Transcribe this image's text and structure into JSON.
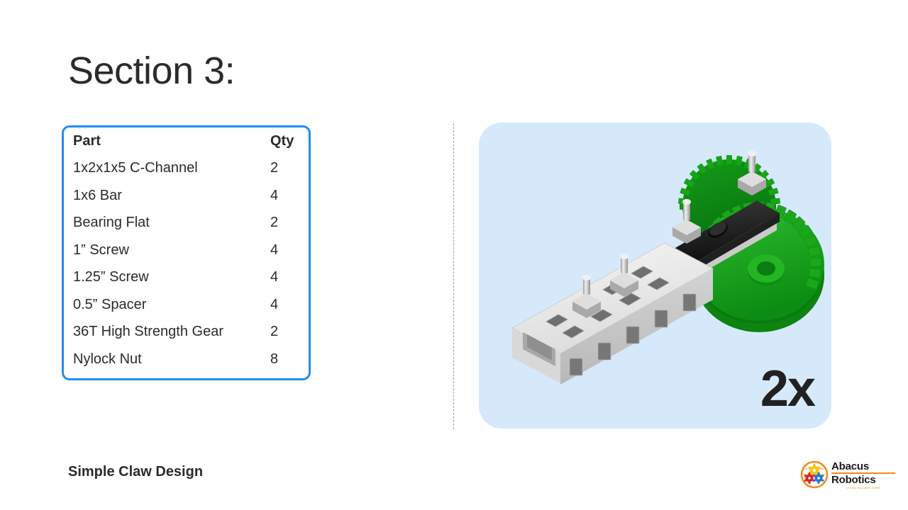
{
  "slide": {
    "title": "Section 3:",
    "footer_label": "Simple Claw Design"
  },
  "parts_table": {
    "columns": [
      "Part",
      "Qty"
    ],
    "rows": [
      {
        "part": "1x2x1x5 C-Channel",
        "qty": "2"
      },
      {
        "part": "1x6 Bar",
        "qty": "4"
      },
      {
        "part": "Bearing Flat",
        "qty": "2"
      },
      {
        "part": "1” Screw",
        "qty": "4"
      },
      {
        "part": "1.25” Screw",
        "qty": "4"
      },
      {
        "part": "0.5” Spacer",
        "qty": "4"
      },
      {
        "part": "36T High Strength Gear",
        "qty": "2"
      },
      {
        "part": "Nylock Nut",
        "qty": "8"
      }
    ],
    "border_color": "#1f8ef1"
  },
  "image_panel": {
    "multiplier": "2x",
    "background_color": "#d6e9fb",
    "assembly_name": "claw-assembly-render",
    "colors": {
      "gear_green": "#18a318",
      "structure_white": "#e8e8e8",
      "bar_black": "#1a1a1a",
      "hardware_silver": "#c9c9c9"
    }
  },
  "logo": {
    "line1": "Abacus",
    "line2": "Robotics",
    "tagline": "a CMU Innovation Center",
    "accent_color": "#f08a1c",
    "gear_colors": [
      "#f5c518",
      "#e02020",
      "#1f78d1"
    ]
  }
}
